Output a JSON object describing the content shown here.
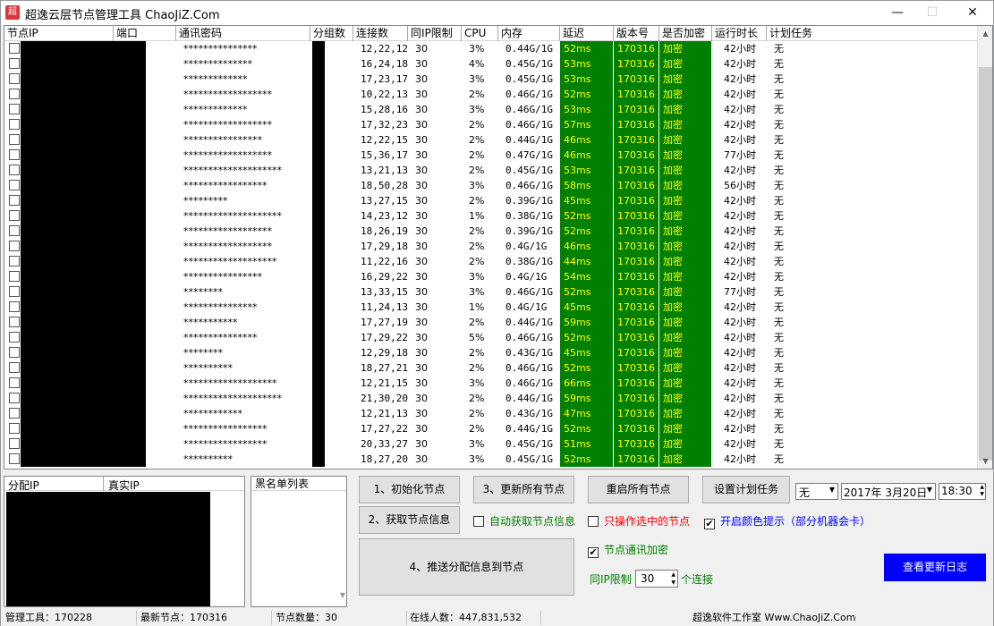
{
  "window": {
    "title": "超逸云层节点管理工具  ChaoJiZ.Com",
    "app_icon": "超",
    "minimize": "—",
    "maximize": "☐",
    "close": "✕"
  },
  "grid": {
    "columns": [
      "节点IP",
      "端口",
      "通讯密码",
      "分组数",
      "连接数",
      "同IP限制",
      "CPU",
      "内存",
      "延迟",
      "版本号",
      "是否加密",
      "运行时长",
      "计划任务"
    ],
    "rows": [
      [
        "***************",
        "12,22,12",
        "30",
        "3%",
        "0.44G/1G",
        "52ms",
        "170316",
        "加密",
        "42小时",
        "无"
      ],
      [
        "**************",
        "16,24,18",
        "30",
        "4%",
        "0.45G/1G",
        "53ms",
        "170316",
        "加密",
        "42小时",
        "无"
      ],
      [
        "*************",
        "17,23,17",
        "30",
        "3%",
        "0.45G/1G",
        "53ms",
        "170316",
        "加密",
        "42小时",
        "无"
      ],
      [
        "******************",
        "10,22,13",
        "30",
        "2%",
        "0.46G/1G",
        "52ms",
        "170316",
        "加密",
        "42小时",
        "无"
      ],
      [
        "*************",
        "15,28,16",
        "30",
        "3%",
        "0.46G/1G",
        "53ms",
        "170316",
        "加密",
        "42小时",
        "无"
      ],
      [
        "******************",
        "17,32,23",
        "30",
        "2%",
        "0.46G/1G",
        "57ms",
        "170316",
        "加密",
        "42小时",
        "无"
      ],
      [
        "****************",
        "12,22,15",
        "30",
        "2%",
        "0.44G/1G",
        "46ms",
        "170316",
        "加密",
        "42小时",
        "无"
      ],
      [
        "******************",
        "15,36,17",
        "30",
        "2%",
        "0.47G/1G",
        "46ms",
        "170316",
        "加密",
        "77小时",
        "无"
      ],
      [
        "********************",
        "13,21,13",
        "30",
        "2%",
        "0.45G/1G",
        "53ms",
        "170316",
        "加密",
        "42小时",
        "无"
      ],
      [
        "*****************",
        "18,50,28",
        "30",
        "3%",
        "0.46G/1G",
        "58ms",
        "170316",
        "加密",
        "56小时",
        "无"
      ],
      [
        "*********",
        "13,27,15",
        "30",
        "2%",
        "0.39G/1G",
        "45ms",
        "170316",
        "加密",
        "42小时",
        "无"
      ],
      [
        "********************",
        "14,23,12",
        "30",
        "1%",
        "0.38G/1G",
        "52ms",
        "170316",
        "加密",
        "42小时",
        "无"
      ],
      [
        "******************",
        "18,26,19",
        "30",
        "2%",
        "0.39G/1G",
        "52ms",
        "170316",
        "加密",
        "42小时",
        "无"
      ],
      [
        "******************",
        "17,29,18",
        "30",
        "2%",
        "0.4G/1G",
        "46ms",
        "170316",
        "加密",
        "42小时",
        "无"
      ],
      [
        "*******************",
        "11,22,16",
        "30",
        "2%",
        "0.38G/1G",
        "44ms",
        "170316",
        "加密",
        "42小时",
        "无"
      ],
      [
        "****************",
        "16,29,22",
        "30",
        "3%",
        "0.4G/1G",
        "54ms",
        "170316",
        "加密",
        "42小时",
        "无"
      ],
      [
        "********",
        "13,33,15",
        "30",
        "3%",
        "0.46G/1G",
        "52ms",
        "170316",
        "加密",
        "77小时",
        "无"
      ],
      [
        "***************",
        "11,24,13",
        "30",
        "1%",
        "0.4G/1G",
        "45ms",
        "170316",
        "加密",
        "42小时",
        "无"
      ],
      [
        "***********",
        "17,27,19",
        "30",
        "2%",
        "0.44G/1G",
        "59ms",
        "170316",
        "加密",
        "42小时",
        "无"
      ],
      [
        "***************",
        "17,29,22",
        "30",
        "5%",
        "0.46G/1G",
        "52ms",
        "170316",
        "加密",
        "42小时",
        "无"
      ],
      [
        "********",
        "12,29,18",
        "30",
        "2%",
        "0.43G/1G",
        "45ms",
        "170316",
        "加密",
        "42小时",
        "无"
      ],
      [
        "**********",
        "18,27,21",
        "30",
        "2%",
        "0.46G/1G",
        "52ms",
        "170316",
        "加密",
        "42小时",
        "无"
      ],
      [
        "*******************",
        "12,21,15",
        "30",
        "3%",
        "0.46G/1G",
        "66ms",
        "170316",
        "加密",
        "42小时",
        "无"
      ],
      [
        "********************",
        "21,30,20",
        "30",
        "2%",
        "0.44G/1G",
        "59ms",
        "170316",
        "加密",
        "42小时",
        "无"
      ],
      [
        "************",
        "12,21,13",
        "30",
        "2%",
        "0.43G/1G",
        "47ms",
        "170316",
        "加密",
        "42小时",
        "无"
      ],
      [
        "*****************",
        "17,27,22",
        "30",
        "2%",
        "0.44G/1G",
        "52ms",
        "170316",
        "加密",
        "42小时",
        "无"
      ],
      [
        "*****************",
        "20,33,27",
        "30",
        "3%",
        "0.45G/1G",
        "51ms",
        "170316",
        "加密",
        "42小时",
        "无"
      ],
      [
        "**********",
        "18,27,20",
        "30",
        "3%",
        "0.45G/1G",
        "52ms",
        "170316",
        "加密",
        "42小时",
        "无"
      ]
    ],
    "scroll_up": "▲",
    "scroll_down": "▼"
  },
  "assign_panel": {
    "col1": "分配IP",
    "col2": "真实IP"
  },
  "blacklist": {
    "header": "黑名单列表"
  },
  "buttons": {
    "init": "1、初始化节点",
    "update_all": "3、更新所有节点",
    "restart_all": "重启所有节点",
    "set_task": "设置计划任务",
    "get_info": "2、获取节点信息",
    "push": "4、推送分配信息到节点",
    "changelog": "查看更新日志"
  },
  "task_controls": {
    "mode": "无",
    "date": "2017年 3月20日",
    "time": "18:30",
    "dropdown_glyph": "▼",
    "spin_up": "▲",
    "spin_down": "▼"
  },
  "checkboxes": {
    "auto_get": {
      "label": "自动获取节点信息",
      "checked": false
    },
    "only_selected": {
      "label": "只操作选中的节点",
      "checked": false
    },
    "color_hint": {
      "label": "开启颜色提示（部分机器会卡）",
      "checked": true
    },
    "encrypt": {
      "label": "节点通讯加密",
      "checked": true
    },
    "check_mark": "✔"
  },
  "ip_limit": {
    "label": "同IP限制",
    "value": "30",
    "unit": "个连接"
  },
  "statusbar": {
    "tool": "管理工具：170228",
    "latest": "最新节点：170316",
    "count": "节点数量：30",
    "online": "在线人数：447,831,532",
    "studio": "超逸软件工作室 Www.ChaoJiZ.Com"
  },
  "colors": {
    "ok": "#008000",
    "ok_text": "#ffff00",
    "accent": "#0000ff",
    "warn": "#ff0000"
  }
}
